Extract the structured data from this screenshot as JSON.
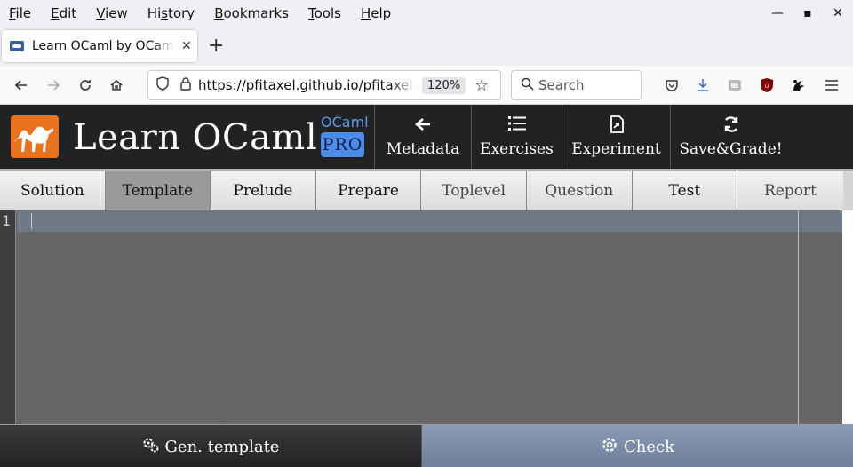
{
  "browser": {
    "menu": [
      "File",
      "Edit",
      "View",
      "History",
      "Bookmarks",
      "Tools",
      "Help"
    ],
    "menu_accel": [
      "F",
      "E",
      "V",
      "s",
      "B",
      "T",
      "H"
    ],
    "window_controls": [
      "minimize-icon",
      "maximize-icon",
      "close-icon"
    ],
    "tab": {
      "title": "Learn OCaml by OCamlPro",
      "close_glyph": "✕"
    },
    "new_tab_glyph": "+",
    "url": "https://pfitaxel.github.io/pfitaxel-demo",
    "zoom": "120%",
    "search_placeholder": "Search",
    "toolbar_icons": [
      "pocket-icon",
      "downloads-icon",
      "reader-icon",
      "ublock-icon",
      "extension-icon",
      "menu-icon"
    ]
  },
  "app": {
    "name": "Learn OCaml",
    "badge_top": "OCaml",
    "badge_bottom": "PRO",
    "header_buttons": [
      {
        "label": "Metadata",
        "icon": "arrow-left-icon"
      },
      {
        "label": "Exercises",
        "icon": "list-icon"
      },
      {
        "label": "Experiment",
        "icon": "experiment-icon"
      },
      {
        "label": "Save&Grade!",
        "icon": "refresh-icon"
      }
    ],
    "editor_tabs": [
      "Solution",
      "Template",
      "Prelude",
      "Prepare",
      "Toplevel",
      "Question",
      "Test",
      "Report"
    ],
    "active_tab": "Template",
    "editor": {
      "line_numbers": [
        "1"
      ]
    },
    "bottom_buttons": [
      {
        "label": "Gen. template",
        "icon": "cogs-icon"
      },
      {
        "label": "Check",
        "icon": "cog-icon"
      }
    ],
    "colors": {
      "header_bg": "#222222",
      "logo_orange": "#e8731c",
      "pro_blue": "#4d8be8",
      "check_bg": "#7b8ba6"
    }
  }
}
